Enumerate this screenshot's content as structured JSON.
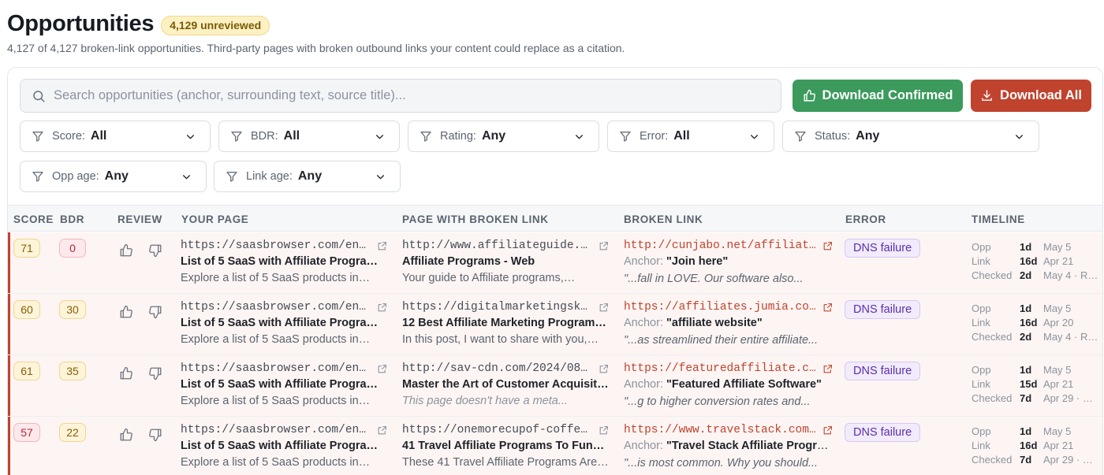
{
  "header": {
    "title": "Opportunities",
    "badge": "4,129 unreviewed",
    "subtitle": "4,127 of 4,127 broken-link opportunities. Third-party pages with broken outbound links your content could replace as a citation."
  },
  "search": {
    "placeholder": "Search opportunities (anchor, surrounding text, source title)..."
  },
  "buttons": {
    "download_confirmed": "Download Confirmed",
    "download_all": "Download All"
  },
  "filters": [
    {
      "label": "Score:",
      "value": "All"
    },
    {
      "label": "BDR:",
      "value": "All"
    },
    {
      "label": "Rating:",
      "value": "Any"
    },
    {
      "label": "Error:",
      "value": "All"
    },
    {
      "label": "Status:",
      "value": "Any"
    },
    {
      "label": "Opp age:",
      "value": "Any"
    },
    {
      "label": "Link age:",
      "value": "Any"
    }
  ],
  "table": {
    "headers": [
      "SCORE",
      "BDR",
      "REVIEW",
      "YOUR PAGE",
      "PAGE WITH BROKEN LINK",
      "BROKEN LINK",
      "ERROR",
      "TIMELINE"
    ],
    "anchor_label": "Anchor:",
    "timeline_labels": [
      "Opp",
      "Link",
      "Checked"
    ],
    "rows": [
      {
        "score": "71",
        "bdr": "0",
        "score_tone": "amber",
        "bdr_tone": "red",
        "your_page_url": "https://saasbrowser.com/en/a…",
        "your_page_title": "List of 5 SaaS with Affiliate Program…",
        "your_page_desc": "Explore a list of 5 SaaS products in…",
        "broken_page_url": "http://www.affiliateguide.co…",
        "broken_page_title": "Affiliate Programs - Web",
        "broken_page_desc": "Your guide to Affiliate programs,…",
        "broken_page_desc_missing": false,
        "link_url": "http://cunjabo.net/affiliate…",
        "anchor": "\"Join here\"",
        "snippet": "\"...fall in LOVE. Our software also...",
        "error": "DNS failure",
        "opp_age": "1d",
        "opp_date": "May 5",
        "link_age": "16d",
        "link_date": "Apr 21",
        "checked_age": "2d",
        "checked_date": "May 4 · R…"
      },
      {
        "score": "60",
        "bdr": "30",
        "score_tone": "amber",
        "bdr_tone": "amber",
        "your_page_url": "https://saasbrowser.com/en/a…",
        "your_page_title": "List of 5 SaaS with Affiliate Program…",
        "your_page_desc": "Explore a list of 5 SaaS products in…",
        "broken_page_url": "https://digitalmarketingskil…",
        "broken_page_title": "12 Best Affiliate Marketing Programs…",
        "broken_page_desc": "In this post, I want to share with you,…",
        "broken_page_desc_missing": false,
        "link_url": "https://affiliates.jumia.com/",
        "anchor": "\"affiliate website\"",
        "snippet": "\"...as streamlined their entire affiliate...",
        "error": "DNS failure",
        "opp_age": "1d",
        "opp_date": "May 5",
        "link_age": "16d",
        "link_date": "Apr 20",
        "checked_age": "2d",
        "checked_date": "May 4 · R…"
      },
      {
        "score": "61",
        "bdr": "35",
        "score_tone": "amber",
        "bdr_tone": "amber",
        "your_page_url": "https://saasbrowser.com/en/a…",
        "your_page_title": "List of 5 SaaS with Affiliate Program…",
        "your_page_desc": "Explore a list of 5 SaaS products in…",
        "broken_page_url": "http://sav-cdn.com/2024/08/0…",
        "broken_page_title": "Master the Art of Customer Acquisiti…",
        "broken_page_desc": "This page doesn't have a meta...",
        "broken_page_desc_missing": true,
        "link_url": "https://featuredaffiliate.co…",
        "anchor": "\"Featured Affiliate Software\"",
        "snippet": "\"...g to higher conversion rates and...",
        "error": "DNS failure",
        "opp_age": "1d",
        "opp_date": "May 5",
        "link_age": "15d",
        "link_date": "Apr 21",
        "checked_age": "7d",
        "checked_date": "Apr 29 · …"
      },
      {
        "score": "57",
        "bdr": "22",
        "score_tone": "red",
        "bdr_tone": "amber",
        "your_page_url": "https://saasbrowser.com/en/a…",
        "your_page_title": "List of 5 SaaS with Affiliate Program…",
        "your_page_desc": "Explore a list of 5 SaaS products in…",
        "broken_page_url": "https://onemorecupof-coffee.…",
        "broken_page_title": "41 Travel Affiliate Programs To Fund …",
        "broken_page_desc": "These 41 Travel Affiliate Programs Are…",
        "broken_page_desc_missing": false,
        "link_url": "https://www.travelstack.com/…",
        "anchor": "\"Travel Stack Affiliate Progra…",
        "snippet": "\"...is most common. Why you should...",
        "error": "DNS failure",
        "opp_age": "1d",
        "opp_date": "May 5",
        "link_age": "16d",
        "link_date": "Apr 21",
        "checked_age": "7d",
        "checked_date": "Apr 29 · …"
      }
    ]
  }
}
